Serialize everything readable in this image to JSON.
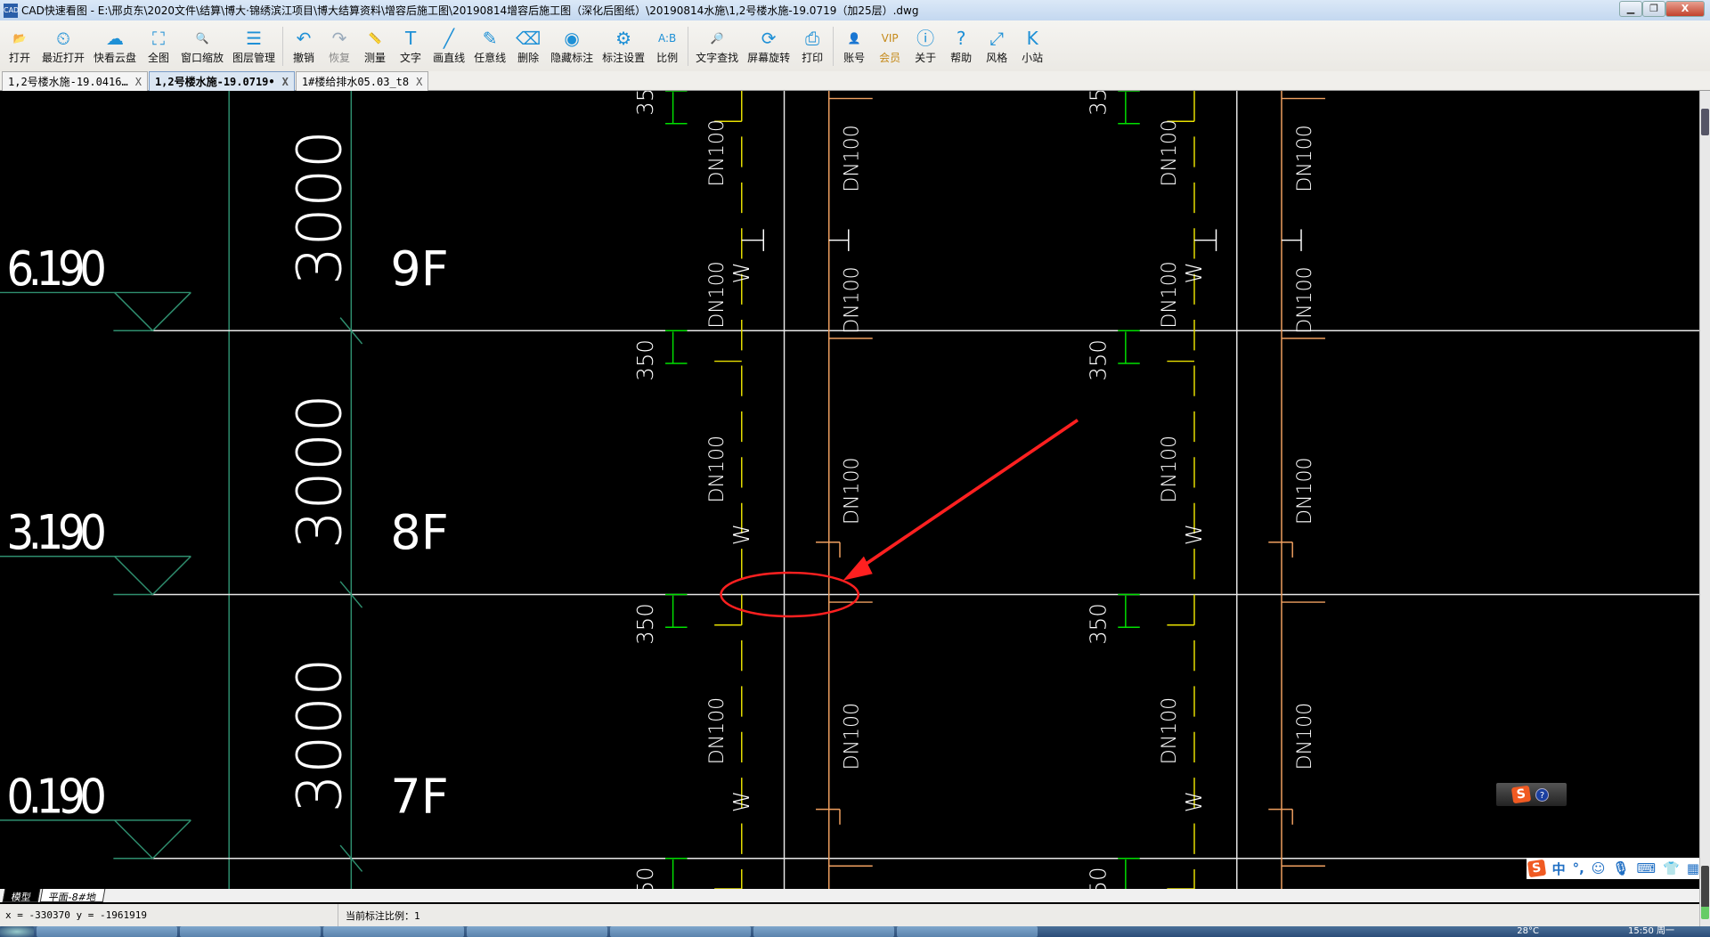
{
  "window": {
    "title": "CAD快速看图 - E:\\邢贞东\\2020文件\\结算\\博大·锦绣滨江项目\\博大结算资料\\增容后施工图\\20190814增容后施工图（深化后图纸）\\20190814水施\\1,2号楼水施-19.0719（加25层）.dwg",
    "app_icon": "cad-app-icon",
    "minimize": "▁",
    "restore": "❐",
    "close": "X"
  },
  "toolbar": {
    "groups": [
      [
        {
          "label": "打开",
          "icon": "📂"
        },
        {
          "label": "最近打开",
          "icon": "⏲"
        },
        {
          "label": "快看云盘",
          "icon": "☁"
        },
        {
          "label": "全图",
          "icon": "⛶"
        },
        {
          "label": "窗口缩放",
          "icon": "🔍"
        },
        {
          "label": "图层管理",
          "icon": "☰"
        }
      ],
      [
        {
          "label": "撤销",
          "icon": "↶"
        },
        {
          "label": "恢复",
          "icon": "↷",
          "disabled": true
        },
        {
          "label": "测量",
          "icon": "📏"
        },
        {
          "label": "文字",
          "icon": "T"
        },
        {
          "label": "画直线",
          "icon": "╱"
        },
        {
          "label": "任意线",
          "icon": "✎"
        },
        {
          "label": "删除",
          "icon": "⌫"
        },
        {
          "label": "隐藏标注",
          "icon": "◉"
        },
        {
          "label": "标注设置",
          "icon": "⚙"
        },
        {
          "label": "比例",
          "icon": "A:B"
        }
      ],
      [
        {
          "label": "文字查找",
          "icon": "🔎"
        },
        {
          "label": "屏幕旋转",
          "icon": "⟳"
        },
        {
          "label": "打印",
          "icon": "⎙"
        }
      ],
      [
        {
          "label": "账号",
          "icon": "👤"
        },
        {
          "label": "会员",
          "icon": "VIP",
          "vip": true
        },
        {
          "label": "关于",
          "icon": "ⓘ"
        },
        {
          "label": "帮助",
          "icon": "?"
        },
        {
          "label": "风格",
          "icon": "⤢"
        },
        {
          "label": "小站",
          "icon": "K"
        }
      ]
    ]
  },
  "tabs": [
    {
      "label": "1,2号楼水施-19.0416…",
      "close": "X"
    },
    {
      "label": "1,2号楼水施-19.0719•",
      "close": "X",
      "active": true
    },
    {
      "label": "1#楼给排水05.03_t8",
      "close": "X"
    }
  ],
  "drawing": {
    "elevations": [
      "6.190",
      "3.190",
      "0.190"
    ],
    "heights": [
      "3000",
      "3000",
      "3000"
    ],
    "floors": [
      "9F",
      "8F",
      "7F"
    ],
    "dim": "350",
    "dim_partial": "35",
    "pipe": "DN100",
    "pipe_mark": "W",
    "colors": {
      "yellow": "#e8e000",
      "orange": "#f0a060",
      "teal": "#2f8f6f",
      "green": "#00e000",
      "red": "#ff2020"
    }
  },
  "layouts": [
    {
      "label": "模型",
      "active": true
    },
    {
      "label": "平面-8#地"
    }
  ],
  "status": {
    "coords": "x = -330370 y = -1961919",
    "scale": "当前标注比例：1"
  },
  "ime": {
    "logo": "S",
    "help": "?",
    "mode": "中",
    "punct": "°,"
  },
  "taskbar": {
    "weather": "28°C",
    "clock": "15:50 周一"
  }
}
